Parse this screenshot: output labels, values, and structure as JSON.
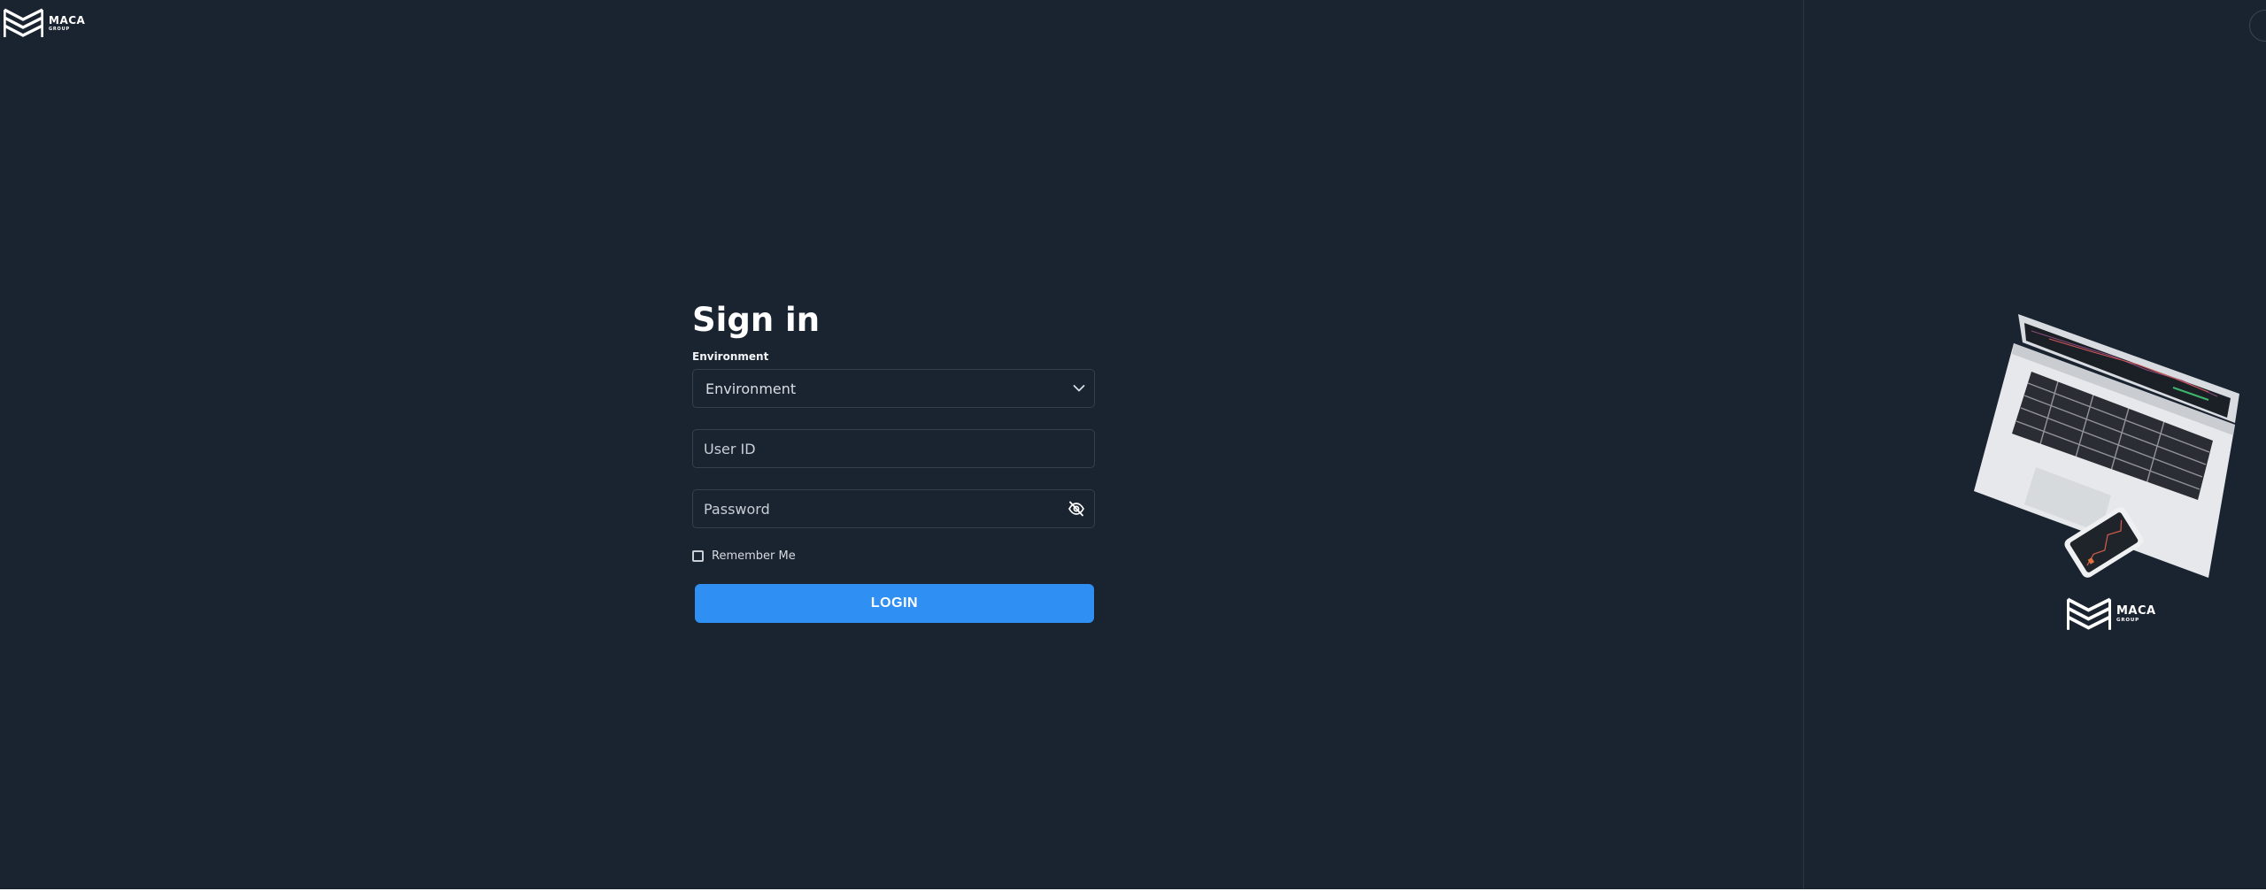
{
  "header": {
    "logo_text": "MACA",
    "logo_subtext": "GROUP"
  },
  "form": {
    "title": "Sign in",
    "environment_label": "Environment",
    "environment_selected": "Environment",
    "user_id_placeholder": "User ID",
    "password_placeholder": "Password",
    "remember_label": "Remember Me",
    "remember_checked": false,
    "login_label": "LOGIN"
  },
  "icons": {
    "select_chevron": "chevron-down-icon",
    "password_toggle": "eye-slash-icon"
  },
  "side_panel": {
    "logo_text": "MACA",
    "logo_subtext": "GROUP"
  },
  "colors": {
    "background": "#1a2330",
    "accent": "#2f8ff2",
    "text": "#ffffff"
  }
}
